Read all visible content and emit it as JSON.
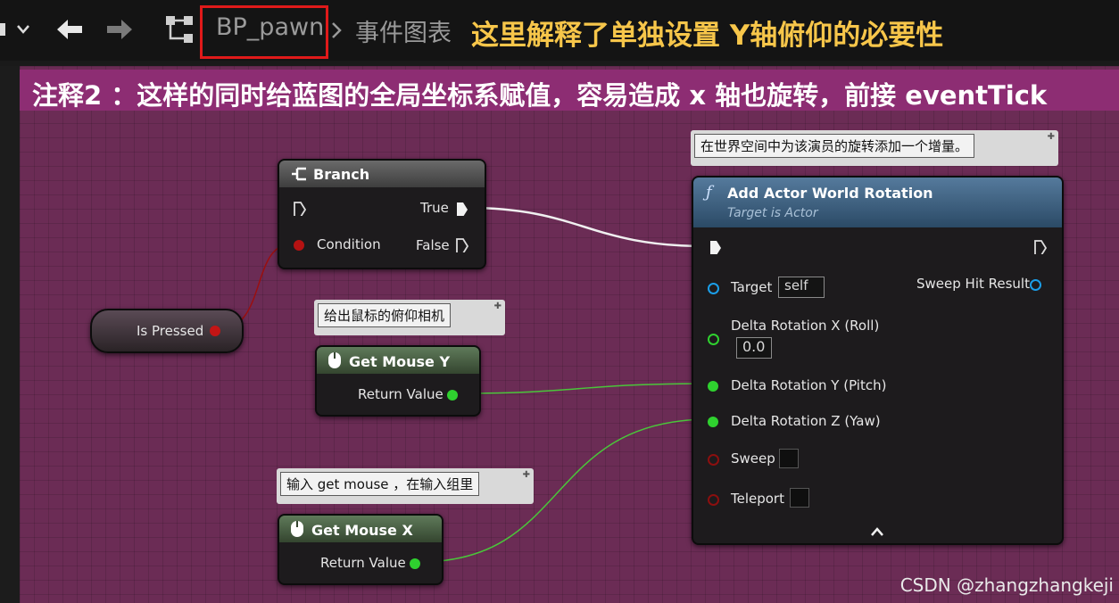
{
  "breadcrumb": {
    "asset": "BP_pawn",
    "graph": "事件图表"
  },
  "annotation_top": "这里解释了单独设置 Y轴俯仰的必要性",
  "comment": {
    "title": "注释2 ：这样的同时给蓝图的全局坐标系赋值，容易造成 x 轴也旋转，前接 eventTick"
  },
  "branch": {
    "title": "Branch",
    "true_label": "True",
    "condition_label": "Condition",
    "false_label": "False"
  },
  "is_pressed": {
    "label": "Is Pressed"
  },
  "mouse_y": {
    "tip": "给出鼠标的俯仰相机",
    "title": "Get Mouse Y",
    "return_label": "Return Value"
  },
  "mouse_x": {
    "tip": "输入 get mouse ，在输入组里",
    "title": "Get Mouse X",
    "return_label": "Return Value"
  },
  "add_rot": {
    "tip": "在世界空间中为该演员的旋转添加一个增量。",
    "title": "Add Actor World Rotation",
    "subtitle": "Target is Actor",
    "target_label": "Target",
    "target_value": "self",
    "sweep_hit_label": "Sweep Hit Result",
    "delta_x_label": "Delta Rotation X (Roll)",
    "delta_x_value": "0.0",
    "delta_y_label": "Delta Rotation Y (Pitch)",
    "delta_z_label": "Delta Rotation Z (Yaw)",
    "sweep_label": "Sweep",
    "teleport_label": "Teleport"
  },
  "watermark": "CSDN @zhangzhangkeji",
  "colors": {
    "comment": "#8d2d73",
    "graph": "#6b2c55",
    "float_pin": "#2fd12f",
    "bool_pin": "#9b0f0f",
    "object_pin": "#1b9ee8",
    "highlight": "#e01a1a",
    "annotation": "#f7c64a"
  },
  "icons": [
    "menu-chevron-icon",
    "back-arrow-icon",
    "forward-arrow-icon",
    "blueprint-graph-icon",
    "breadcrumb-chevron-icon",
    "branch-icon",
    "function-icon",
    "mouse-icon",
    "pin-icon",
    "collapse-chevron-icon"
  ]
}
